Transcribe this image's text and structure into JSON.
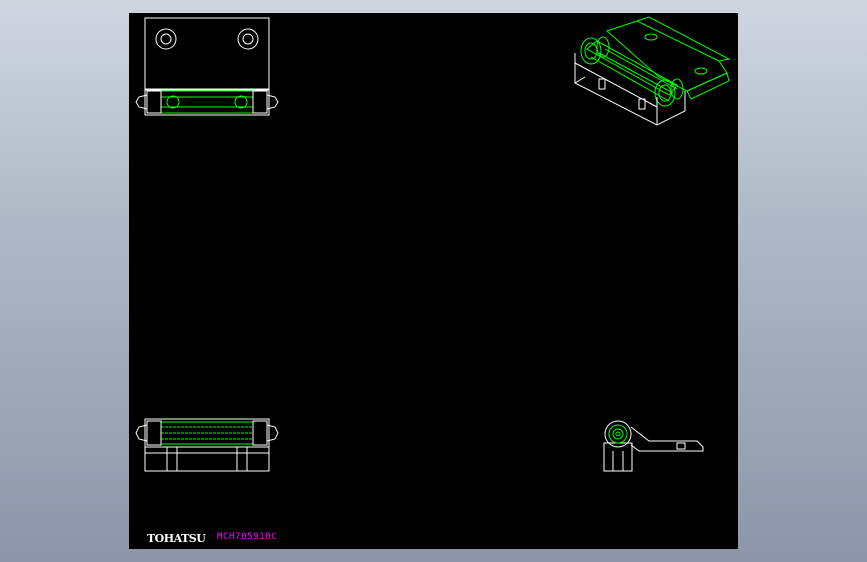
{
  "drawing": {
    "brand": "TOHATSU",
    "part_code": "MCH705910C"
  },
  "colors": {
    "background": "#000000",
    "line_white": "#ffffff",
    "line_green": "#00ff00",
    "text_magenta": "#ff00ff",
    "frame_gradient_top": "#cfd6e0",
    "frame_gradient_bottom": "#8c96a8"
  },
  "views": [
    "top-view",
    "isometric-view",
    "front-view",
    "side-view"
  ]
}
